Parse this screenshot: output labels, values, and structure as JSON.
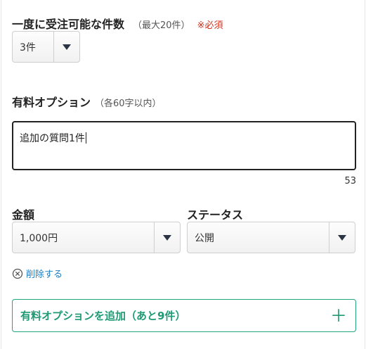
{
  "capacity": {
    "label": "一度に受注可能な件数",
    "note": "（最大20件）",
    "required": "※必須",
    "select_value": "3件"
  },
  "option": {
    "label": "有料オプション",
    "note": "（各60字以内）",
    "text_value": "追加の質問1件",
    "remaining_chars": "53"
  },
  "price": {
    "label": "金額",
    "select_value": "1,000円"
  },
  "status": {
    "label": "ステータス",
    "select_value": "公開"
  },
  "delete": {
    "label": "削除する",
    "icon": "circle-x-icon"
  },
  "add_option": {
    "label": "有料オプションを追加（あと9件）",
    "icon": "plus-icon"
  },
  "colors": {
    "accent_green": "#1f9a74",
    "link_blue": "#1b7fc4",
    "required_red": "#d0311a"
  }
}
